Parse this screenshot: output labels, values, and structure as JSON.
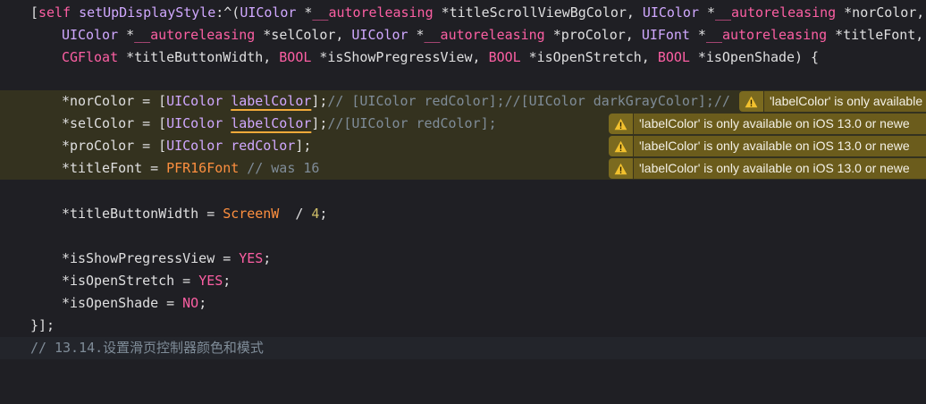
{
  "colors": {
    "background": "#1f1f24",
    "warning_highlight_line": "#34321f",
    "keyword": "#fc5fa3",
    "type": "#5dd8ff",
    "class_method": "#d0a8ff",
    "comment": "#7f8c98",
    "macro": "#fd8f3f",
    "number": "#d0bf69",
    "warning_badge": "#6b5c1c",
    "underline": "#f0a93a"
  },
  "lines": {
    "l1": {
      "a": "[",
      "b": "self",
      "c": " ",
      "d": "setUpDisplayStyle",
      "e": ":^(",
      "f": "UIColor",
      "g": " *",
      "h": "__autoreleasing",
      "i": " *titleScrollViewBgColor, ",
      "j": "UIColor",
      "k": " *",
      "l": "__autoreleasing",
      "m": " *norColor,"
    },
    "l2": {
      "a": "UIColor",
      "b": " *",
      "c": "__autoreleasing",
      "d": " *selColor, ",
      "e": "UIColor",
      "f": " *",
      "g": "__autoreleasing",
      "h": " *proColor, ",
      "i": "UIFont",
      "j": " *",
      "k": "__autoreleasing",
      "l": " *titleFont,"
    },
    "l3": {
      "a": "CGFloat",
      "b": " *titleButtonWidth, ",
      "c": "BOOL",
      "d": " *isShowPregressView, ",
      "e": "BOOL",
      "f": " *isOpenStretch, ",
      "g": "BOOL",
      "h": " *isOpenShade) {"
    },
    "l5": {
      "a": "*norColor = [",
      "b": "UIColor",
      "c": " ",
      "d": "labelColor",
      "e": "];",
      "f": "// [UIColor redColor];//[UIColor darkGrayColor];//"
    },
    "l6": {
      "a": "*selColor = [",
      "b": "UIColor",
      "c": " ",
      "d": "labelColor",
      "e": "];",
      "f": "//[UIColor redColor];"
    },
    "l7": {
      "a": "*proColor = [",
      "b": "UIColor",
      "c": " ",
      "d": "redColor",
      "e": "];"
    },
    "l8": {
      "a": "*titleFont = ",
      "b": "PFR16Font",
      "c": " ",
      "d": "// was 16"
    },
    "l10": {
      "a": "*titleButtonWidth = ",
      "b": "ScreenW",
      "c": "  / ",
      "d": "4",
      "e": ";"
    },
    "l12": {
      "a": "*isShowPregressView = ",
      "b": "YES",
      "c": ";"
    },
    "l13": {
      "a": "*isOpenStretch = ",
      "b": "YES",
      "c": ";"
    },
    "l14": {
      "a": "*isOpenShade = ",
      "b": "NO",
      "c": ";"
    },
    "l15": {
      "a": "}];"
    },
    "l16": {
      "a": "// 13.14.设置滑页控制器颜色和模式"
    }
  },
  "warnings": {
    "w1": "'labelColor' is only available",
    "w2": "'labelColor' is only available on iOS 13.0 or newe",
    "w3": "'labelColor' is only available on iOS 13.0 or newe",
    "w4": "'labelColor' is only available on iOS 13.0 or newe"
  },
  "icons": {
    "warning": "warning-triangle-icon"
  }
}
